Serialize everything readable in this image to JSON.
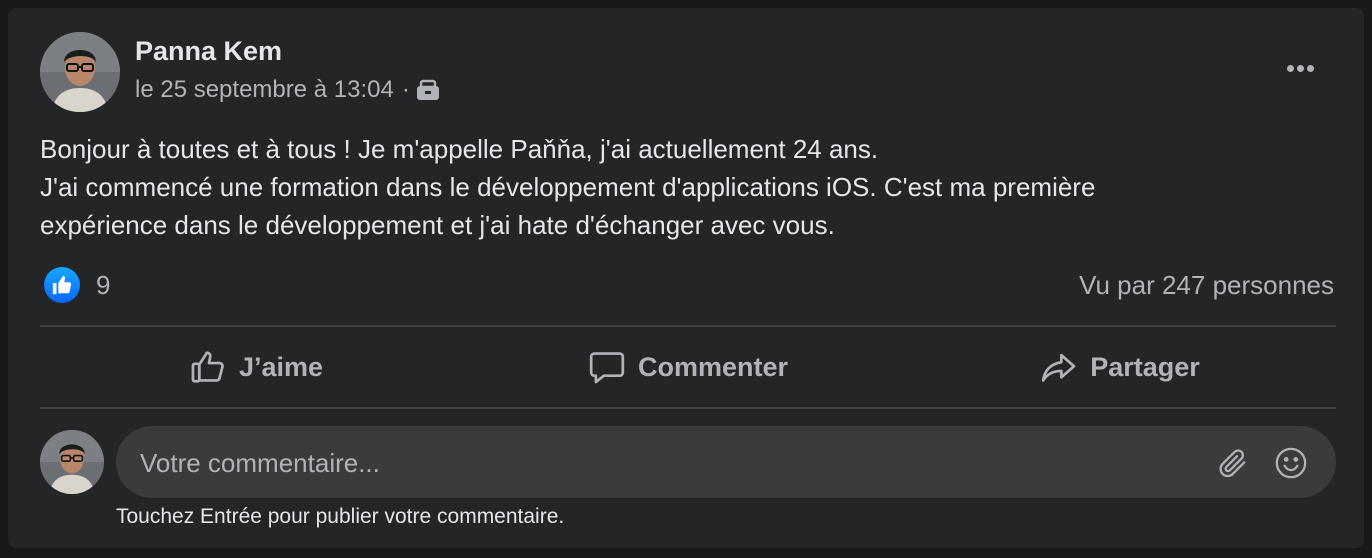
{
  "post": {
    "author": "Panna Kem",
    "date": "le 25 septembre à 13:04",
    "separator": "·",
    "audience_icon": "briefcase-icon",
    "more_icon": "more-options-icon",
    "text_lines": [
      "Bonjour à toutes et à tous ! Je m'appelle Paňňa, j'ai actuellement 24 ans.",
      "J'ai commencé une formation dans le développement d'applications iOS. C'est ma première",
      "expérience dans le développement et j'ai hate d'échanger avec vous."
    ],
    "reactions": {
      "icon": "thumbs-up-icon",
      "count": "9"
    },
    "seen_by": "Vu par 247 personnes"
  },
  "actions": {
    "like": "J’aime",
    "comment": "Commenter",
    "share": "Partager"
  },
  "composer": {
    "placeholder": "Votre commentaire...",
    "hint": "Touchez Entrée pour publier votre commentaire.",
    "attach_icon": "paperclip-icon",
    "emoji_icon": "smiley-icon"
  },
  "colors": {
    "page_bg": "#18191a",
    "card_bg": "#242526",
    "input_bg": "#3a3b3c",
    "primary_text": "#e4e6eb",
    "secondary_text": "#b0b3b8",
    "like_blue": "#0866ff"
  }
}
